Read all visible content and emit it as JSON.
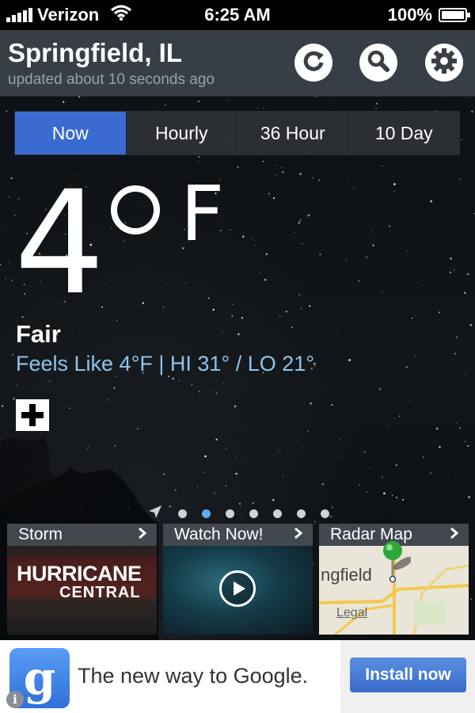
{
  "status_bar": {
    "carrier": "Verizon",
    "time": "6:25 AM",
    "battery": "100%",
    "icons": [
      "signal-icon",
      "wifi-icon",
      "battery-icon"
    ]
  },
  "header": {
    "city": "Springfield, IL",
    "updated": "updated about 10 seconds ago",
    "buttons": [
      "refresh-icon",
      "search-icon",
      "gear-icon"
    ]
  },
  "tabs": [
    {
      "label": "Now",
      "active": true
    },
    {
      "label": "Hourly",
      "active": false
    },
    {
      "label": "36 Hour",
      "active": false
    },
    {
      "label": "10 Day",
      "active": false
    }
  ],
  "current": {
    "temperature": "4",
    "unit": "F",
    "condition": "Fair",
    "feels_like": "Feels Like 4°F | HI 31° / LO 21°"
  },
  "pager": {
    "pages": 7,
    "active_index": 1
  },
  "cards": [
    {
      "title": "Storm",
      "image_text_1": "HURRICANE",
      "image_text_2": "CENTRAL"
    },
    {
      "title": "Watch Now!"
    },
    {
      "title": "Radar Map",
      "map_label": "ngfield",
      "legal": "Legal"
    }
  ],
  "ad": {
    "logo_letter": "g",
    "text": "The new way to Google.",
    "install": "Install now",
    "info": "i"
  },
  "colors": {
    "accent_tab": "#3a6bd0",
    "feels_like": "#8ec4ee",
    "pager_active": "#58aef0"
  }
}
